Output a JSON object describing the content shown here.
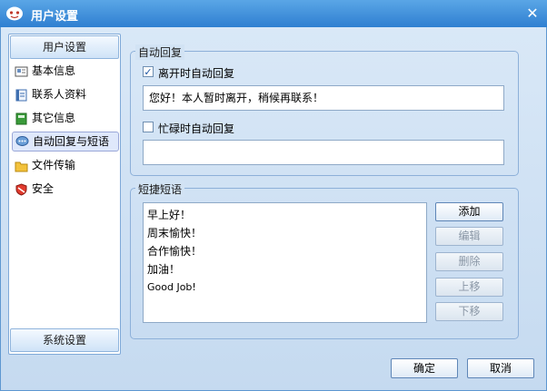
{
  "window": {
    "title": "用户设置",
    "close_glyph": "✕"
  },
  "icons": {
    "app": "chat-bubble-icon",
    "basic_info": "id-card-icon",
    "contacts": "contact-book-icon",
    "other_info": "green-book-icon",
    "auto_reply": "speech-bubble-icon",
    "file_transfer": "folder-icon",
    "security": "shield-icon"
  },
  "sidebar": {
    "header": "用户设置",
    "items": [
      {
        "label": "基本信息"
      },
      {
        "label": "联系人资料"
      },
      {
        "label": "其它信息"
      },
      {
        "label": "自动回复与短语"
      },
      {
        "label": "文件传输"
      },
      {
        "label": "安全"
      }
    ],
    "footer": "系统设置"
  },
  "auto_reply": {
    "group_label": "自动回复",
    "away_check_label": "离开时自动回复",
    "away_checked": true,
    "away_message": "您好！本人暂时离开，稍候再联系！",
    "busy_check_label": "忙碌时自动回复",
    "busy_checked": false,
    "busy_message": ""
  },
  "quick_phrases": {
    "group_label": "短捷短语",
    "items": [
      "早上好！",
      "周末愉快！",
      "合作愉快！",
      "加油！",
      "Good Job!"
    ],
    "buttons": {
      "add": "添加",
      "edit": "编辑",
      "delete": "删除",
      "up": "上移",
      "down": "下移"
    }
  },
  "dialog_buttons": {
    "ok": "确定",
    "cancel": "取消"
  },
  "colors": {
    "titlebar": "#2f7fd1",
    "client_bg": "#c9dcf0",
    "border": "#8db0d9"
  }
}
